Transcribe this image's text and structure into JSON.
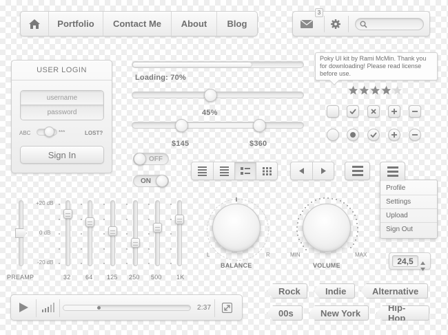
{
  "nav": {
    "home_icon": "home-icon",
    "items": [
      "Portfolio",
      "Contact Me",
      "About",
      "Blog"
    ]
  },
  "toolbar": {
    "mail_badge": "3",
    "mail_icon": "mail-icon",
    "gear_icon": "gear-icon",
    "search_icon": "search-icon",
    "search_placeholder": ""
  },
  "login": {
    "title": "USER LOGIN",
    "username_placeholder": "username",
    "password_placeholder": "password",
    "toggle_left": "ABC",
    "toggle_right": "***",
    "lost_link": "LOST?",
    "sign_in": "Sign In"
  },
  "progress": {
    "loading_text": "Loading: 70%",
    "loading_value": 0.7,
    "slider_value_text": "45%",
    "slider_value": 0.45,
    "range_low": "$145",
    "range_high": "$360"
  },
  "tooltip": {
    "text": "Poky UI kit by Rami McMin. Thank you for downloading! Please read license before use."
  },
  "rating": {
    "value": 4,
    "max": 5
  },
  "toggles": {
    "off_label": "OFF",
    "on_label": "ON"
  },
  "equalizer": {
    "scale_top": "+20 dB",
    "scale_mid": "0 dB",
    "scale_bottom": "-20 dB",
    "preamp_label": "PREAMP",
    "bands": [
      "32",
      "64",
      "125",
      "250",
      "500",
      "1K"
    ]
  },
  "knobs": {
    "balance_label": "BALANCE",
    "balance_left": "L",
    "balance_right": "R",
    "volume_label": "VOLUME",
    "volume_min": "MIN",
    "volume_max": "MAX"
  },
  "menu": {
    "items": [
      "Profile",
      "Settings",
      "Upload",
      "Sign Out"
    ]
  },
  "stepper": {
    "value": "24,5"
  },
  "tags": {
    "row1": [
      "Rock",
      "Indie",
      "Alternative"
    ],
    "row2": [
      "00s",
      "New York",
      "Hip-Hop"
    ]
  },
  "player": {
    "time": "2:37",
    "progress": 0.28,
    "play_icon": "play-icon",
    "volume_icon": "volume-bars-icon",
    "fullscreen_icon": "fullscreen-icon"
  }
}
